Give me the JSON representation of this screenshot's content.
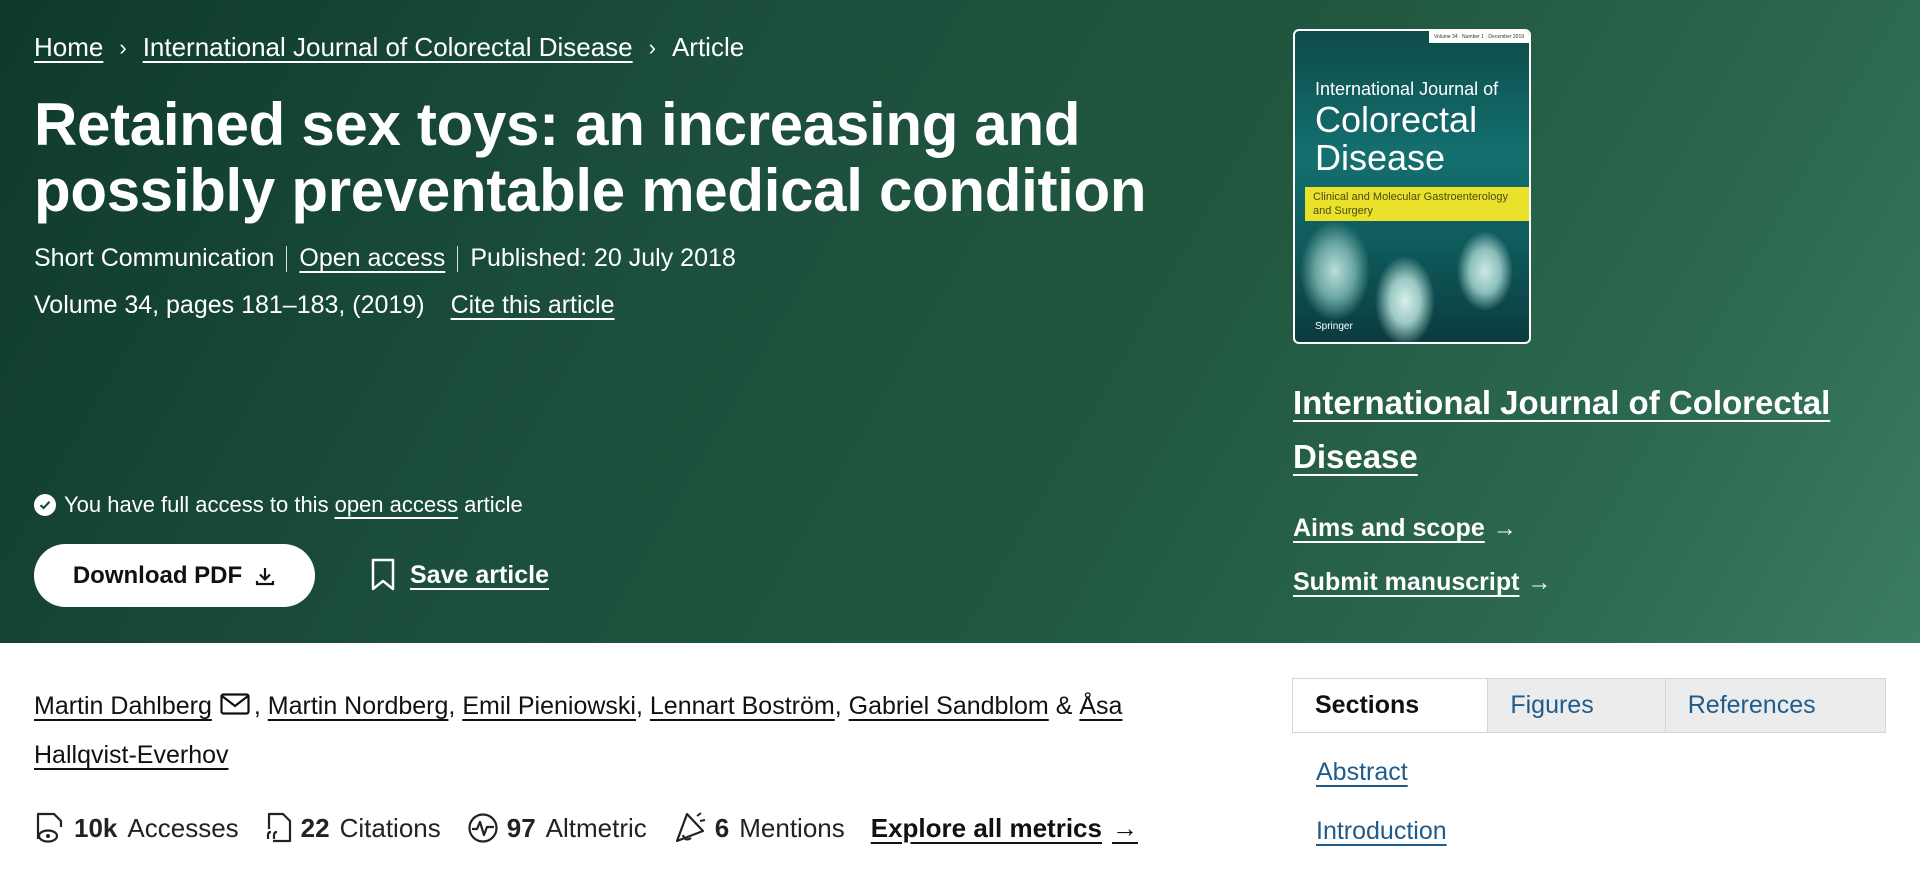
{
  "breadcrumb": {
    "home": "Home",
    "journal": "International Journal of Colorectal Disease",
    "current": "Article"
  },
  "article": {
    "title": "Retained sex toys: an increasing and possibly preventable medical condition",
    "type": "Short Communication",
    "open_access": "Open access",
    "published": "Published: 20 July 2018",
    "volume": "Volume 34, pages 181–183, (2019)",
    "cite": "Cite this article"
  },
  "access": {
    "prefix": "You have full access to this",
    "link": "open access",
    "suffix": "article"
  },
  "actions": {
    "download_pdf": "Download PDF",
    "save_article": "Save article"
  },
  "cover": {
    "volume_strip": "Volume 34 · Number 1 · December 2019",
    "line1": "International Journal of",
    "line2": "Colorectal Disease",
    "band": "Clinical and Molecular Gastroenterology and Surgery",
    "publisher": "Springer"
  },
  "journal_sidebar": {
    "journal_name": "International Journal of Colorectal Disease",
    "aims": "Aims and scope",
    "submit": "Submit manuscript"
  },
  "authors": {
    "a1": "Martin Dahlberg",
    "a2": "Martin Nordberg",
    "a3": "Emil Pieniowski",
    "a4": "Lennart Boström",
    "a5": "Gabriel Sandblom",
    "amp": "&",
    "a6": "Åsa Hallqvist-Everhov"
  },
  "metrics": {
    "accesses_value": "10k",
    "accesses_label": "Accesses",
    "citations_value": "22",
    "citations_label": "Citations",
    "altmetric_value": "97",
    "altmetric_label": "Altmetric",
    "mentions_value": "6",
    "mentions_label": "Mentions",
    "explore": "Explore all metrics"
  },
  "tabs": [
    {
      "label": "Sections"
    },
    {
      "label": "Figures"
    },
    {
      "label": "References"
    }
  ],
  "toc": {
    "abstract": "Abstract",
    "introduction": "Introduction"
  }
}
